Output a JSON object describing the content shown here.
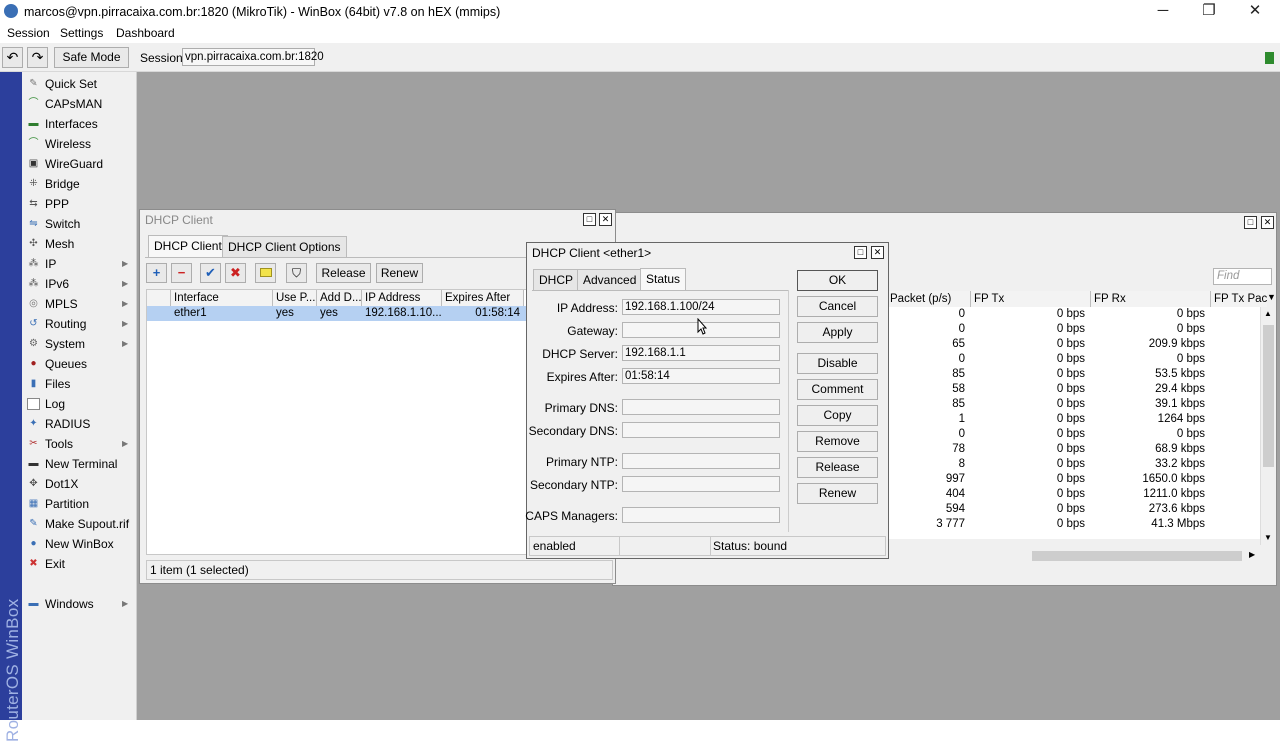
{
  "window": {
    "title": "marcos@vpn.pirracaixa.com.br:1820 (MikroTik) - WinBox (64bit) v7.8 on hEX (mmips)",
    "minimize": "─",
    "maximize": "❐",
    "close": "✕"
  },
  "menu": [
    "Session",
    "Settings",
    "Dashboard"
  ],
  "toolbar": {
    "undo": "↶",
    "redo": "↷",
    "safe_mode": "Safe Mode",
    "session_label": "Session:",
    "session_value": "vpn.pirracaixa.com.br:1820"
  },
  "brand": "RouterOS WinBox",
  "sidebar": {
    "items": [
      {
        "label": "Quick Set",
        "icon": "wand-icon",
        "glyph": "✎",
        "color": "#777"
      },
      {
        "label": "CAPsMAN",
        "icon": "capsman-icon",
        "glyph": "⌒",
        "color": "#3a8f3a"
      },
      {
        "label": "Interfaces",
        "icon": "interfaces-icon",
        "glyph": "▬",
        "color": "#2f7d2f"
      },
      {
        "label": "Wireless",
        "icon": "wireless-icon",
        "glyph": "⌒",
        "color": "#3a8f3a"
      },
      {
        "label": "WireGuard",
        "icon": "wireguard-icon",
        "glyph": "▣",
        "color": "#333"
      },
      {
        "label": "Bridge",
        "icon": "bridge-icon",
        "glyph": "⁜",
        "color": "#555"
      },
      {
        "label": "PPP",
        "icon": "ppp-icon",
        "glyph": "⇆",
        "color": "#555"
      },
      {
        "label": "Switch",
        "icon": "switch-icon",
        "glyph": "⇋",
        "color": "#3a6fb5"
      },
      {
        "label": "Mesh",
        "icon": "mesh-icon",
        "glyph": "✣",
        "color": "#555"
      },
      {
        "label": "IP",
        "icon": "ip-icon",
        "glyph": "⁂",
        "color": "#555",
        "arrow": true
      },
      {
        "label": "IPv6",
        "icon": "ipv6-icon",
        "glyph": "⁂",
        "color": "#555",
        "arrow": true
      },
      {
        "label": "MPLS",
        "icon": "mpls-icon",
        "glyph": "◎",
        "color": "#777",
        "arrow": true
      },
      {
        "label": "Routing",
        "icon": "routing-icon",
        "glyph": "↺",
        "color": "#3a6fb5",
        "arrow": true
      },
      {
        "label": "System",
        "icon": "system-icon",
        "glyph": "⚙",
        "color": "#666",
        "arrow": true
      },
      {
        "label": "Queues",
        "icon": "queues-icon",
        "glyph": "●",
        "color": "#a02020"
      },
      {
        "label": "Files",
        "icon": "files-icon",
        "glyph": "▮",
        "color": "#3a6fb5"
      },
      {
        "label": "Log",
        "icon": "log-icon",
        "glyph": "▭",
        "color": "#fff"
      },
      {
        "label": "RADIUS",
        "icon": "radius-icon",
        "glyph": "✦",
        "color": "#3a6fb5"
      },
      {
        "label": "Tools",
        "icon": "tools-icon",
        "glyph": "✂",
        "color": "#b03030",
        "arrow": true
      },
      {
        "label": "New Terminal",
        "icon": "terminal-icon",
        "glyph": "▬",
        "color": "#333"
      },
      {
        "label": "Dot1X",
        "icon": "dot1x-icon",
        "glyph": "✥",
        "color": "#555"
      },
      {
        "label": "Partition",
        "icon": "partition-icon",
        "glyph": "▦",
        "color": "#3a6fb5"
      },
      {
        "label": "Make Supout.rif",
        "icon": "supout-icon",
        "glyph": "✎",
        "color": "#3a6fb5"
      },
      {
        "label": "New WinBox",
        "icon": "winbox-icon",
        "glyph": "●",
        "color": "#3a6fb5"
      },
      {
        "label": "Exit",
        "icon": "exit-icon",
        "glyph": "✖",
        "color": "#c33"
      }
    ],
    "windows": {
      "label": "Windows",
      "icon": "windows-icon",
      "glyph": "▬",
      "color": "#3a6fb5",
      "arrow": true
    }
  },
  "dhcp_client_window": {
    "title": "DHCP Client",
    "tabs": [
      "DHCP Client",
      "DHCP Client Options"
    ],
    "buttons": {
      "release": "Release",
      "renew": "Renew"
    },
    "columns": [
      "Interface",
      "Use P...",
      "Add D...",
      "IP Address",
      "Expires After"
    ],
    "rows": [
      {
        "interface": "ether1",
        "use_peer": "yes",
        "add_default": "yes",
        "ip": "192.168.1.10...",
        "expires": "01:58:14"
      }
    ],
    "status": "1 item (1 selected)"
  },
  "bg_table_window": {
    "find_placeholder": "Find",
    "columns": [
      "Packet (p/s)",
      "FP Tx",
      "FP Rx",
      "FP Tx Pac"
    ],
    "rows": [
      [
        "0",
        "0 bps",
        "0 bps"
      ],
      [
        "0",
        "0 bps",
        "0 bps"
      ],
      [
        "65",
        "0 bps",
        "209.9 kbps"
      ],
      [
        "0",
        "0 bps",
        "0 bps"
      ],
      [
        "85",
        "0 bps",
        "53.5 kbps"
      ],
      [
        "58",
        "0 bps",
        "29.4 kbps"
      ],
      [
        "85",
        "0 bps",
        "39.1 kbps"
      ],
      [
        "1",
        "0 bps",
        "1264 bps"
      ],
      [
        "0",
        "0 bps",
        "0 bps"
      ],
      [
        "78",
        "0 bps",
        "68.9 kbps"
      ],
      [
        "8",
        "0 bps",
        "33.2 kbps"
      ],
      [
        "997",
        "0 bps",
        "1650.0 kbps"
      ],
      [
        "404",
        "0 bps",
        "1211.0 kbps"
      ],
      [
        "594",
        "0 bps",
        "273.6 kbps"
      ],
      [
        "3 777",
        "0 bps",
        "41.3 Mbps"
      ]
    ]
  },
  "dialog": {
    "title": "DHCP Client <ether1>",
    "tabs": [
      "DHCP",
      "Advanced",
      "Status"
    ],
    "fields": {
      "ip_address": {
        "label": "IP Address:",
        "value": "192.168.1.100/24"
      },
      "gateway": {
        "label": "Gateway:",
        "value": ""
      },
      "dhcp_server": {
        "label": "DHCP Server:",
        "value": "192.168.1.1"
      },
      "expires_after": {
        "label": "Expires After:",
        "value": "01:58:14"
      },
      "primary_dns": {
        "label": "Primary DNS:",
        "value": ""
      },
      "secondary_dns": {
        "label": "Secondary DNS:",
        "value": ""
      },
      "primary_ntp": {
        "label": "Primary NTP:",
        "value": ""
      },
      "secondary_ntp": {
        "label": "Secondary NTP:",
        "value": ""
      },
      "caps_managers": {
        "label": "CAPS Managers:",
        "value": ""
      }
    },
    "buttons": [
      "OK",
      "Cancel",
      "Apply",
      "Disable",
      "Comment",
      "Copy",
      "Remove",
      "Release",
      "Renew"
    ],
    "status_left": "enabled",
    "status_right": "Status: bound"
  },
  "colors": {
    "workspace": "#a0a0a0",
    "brand_strip": "#2c3f9c",
    "selection": "#b5d0f2",
    "safe_mode_indicator": "#2e8b2e"
  }
}
